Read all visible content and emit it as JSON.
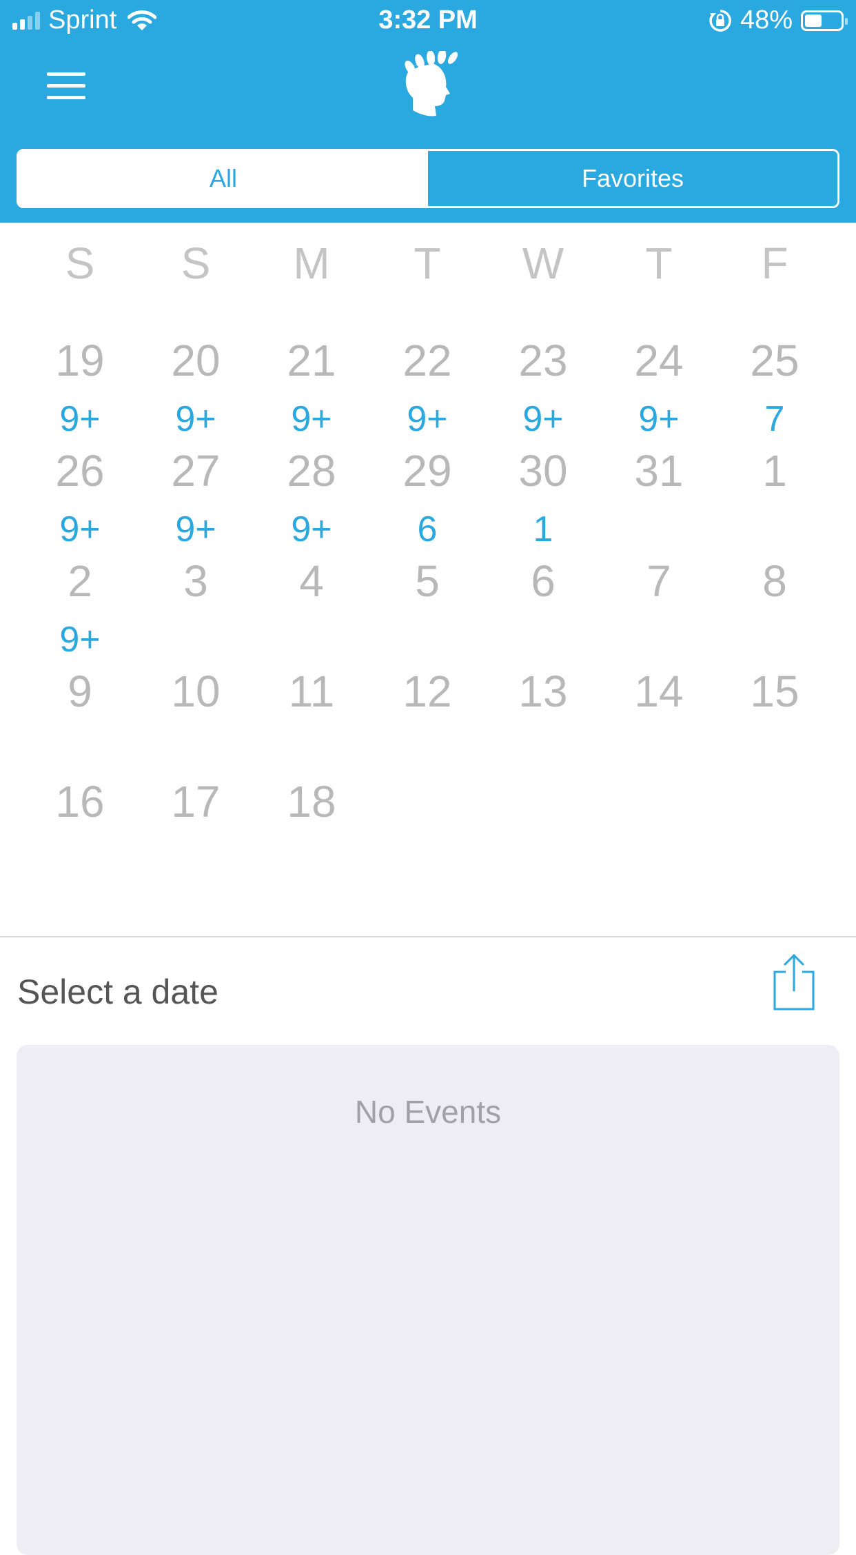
{
  "status_bar": {
    "carrier": "Sprint",
    "time": "3:32 PM",
    "battery_text": "48%",
    "battery_level": 0.48
  },
  "header": {
    "segments": [
      {
        "label": "All",
        "active": true
      },
      {
        "label": "Favorites",
        "active": false
      }
    ]
  },
  "calendar": {
    "weekdays": [
      "S",
      "S",
      "M",
      "T",
      "W",
      "T",
      "F"
    ],
    "rows": [
      [
        {
          "d": "19",
          "c": "9+"
        },
        {
          "d": "20",
          "c": "9+"
        },
        {
          "d": "21",
          "c": "9+"
        },
        {
          "d": "22",
          "c": "9+"
        },
        {
          "d": "23",
          "c": "9+"
        },
        {
          "d": "24",
          "c": "9+"
        },
        {
          "d": "25",
          "c": "7"
        }
      ],
      [
        {
          "d": "26",
          "c": "9+"
        },
        {
          "d": "27",
          "c": "9+"
        },
        {
          "d": "28",
          "c": "9+"
        },
        {
          "d": "29",
          "c": "6"
        },
        {
          "d": "30",
          "c": "1"
        },
        {
          "d": "31",
          "c": ""
        },
        {
          "d": "1",
          "c": ""
        }
      ],
      [
        {
          "d": "2",
          "c": "9+"
        },
        {
          "d": "3",
          "c": ""
        },
        {
          "d": "4",
          "c": ""
        },
        {
          "d": "5",
          "c": ""
        },
        {
          "d": "6",
          "c": ""
        },
        {
          "d": "7",
          "c": ""
        },
        {
          "d": "8",
          "c": ""
        }
      ],
      [
        {
          "d": "9",
          "c": ""
        },
        {
          "d": "10",
          "c": ""
        },
        {
          "d": "11",
          "c": ""
        },
        {
          "d": "12",
          "c": ""
        },
        {
          "d": "13",
          "c": ""
        },
        {
          "d": "14",
          "c": ""
        },
        {
          "d": "15",
          "c": ""
        }
      ],
      [
        {
          "d": "16",
          "c": ""
        },
        {
          "d": "17",
          "c": ""
        },
        {
          "d": "18",
          "c": ""
        }
      ]
    ]
  },
  "events_section": {
    "title": "Select a date",
    "empty_text": "No Events"
  },
  "colors": {
    "accent": "#2aa8e0",
    "panel": "#eeedf3"
  },
  "icons": {
    "menu": "hamburger-menu-icon",
    "logo": "laurel-head-logo",
    "share": "share-icon"
  }
}
